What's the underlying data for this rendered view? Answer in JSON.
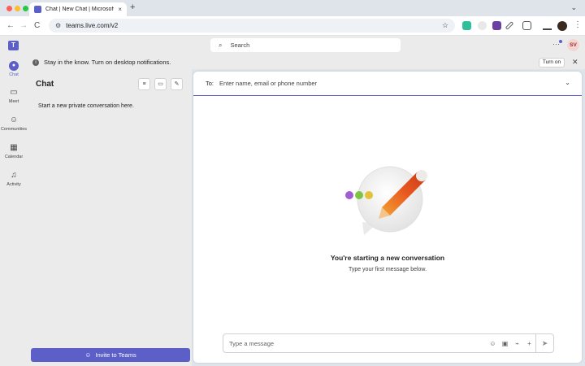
{
  "browser": {
    "tab_title": "Chat | New Chat | Microsoft T",
    "tab_close": "×",
    "new_tab": "+",
    "tab_menu": "⌄",
    "url": "teams.live.com/v2",
    "back": "←",
    "forward": "→",
    "reload": "C",
    "bookmark": "☆",
    "menu": "⋮",
    "colors": {
      "close": "#ff5f57",
      "minimize": "#febc2e",
      "maximize": "#28c840"
    }
  },
  "header": {
    "logo_letter": "T",
    "search_placeholder": "Search",
    "search_icon": "⌕",
    "more": "···",
    "avatar_initials": "SV"
  },
  "banner": {
    "icon": "i",
    "message": "Stay in the know. Turn on desktop notifications.",
    "turn_on": "Turn on",
    "close": "✕"
  },
  "rail": {
    "items": [
      {
        "label": "Chat",
        "icon": "chat-icon",
        "glyph": "●"
      },
      {
        "label": "Meet",
        "icon": "video-icon",
        "glyph": "▭"
      },
      {
        "label": "Communities",
        "icon": "communities-icon",
        "glyph": "☺"
      },
      {
        "label": "Calendar",
        "icon": "calendar-icon",
        "glyph": "▦"
      },
      {
        "label": "Activity",
        "icon": "bell-icon",
        "glyph": "♫"
      }
    ]
  },
  "chatlist": {
    "title": "Chat",
    "filter": "≡",
    "meet": "▭",
    "new_chat": "✎",
    "empty": "Start a new private conversation here.",
    "invite_label": "Invite to Teams",
    "invite_icon": "☺"
  },
  "conversation": {
    "to_label": "To:",
    "to_placeholder": "Enter name, email or phone number",
    "chevron": "⌄",
    "heading": "You're starting a new conversation",
    "subtext": "Type your first message below.",
    "composer_placeholder": "Type a message",
    "emoji": "☺",
    "gif": "▣",
    "attach": "⌁",
    "add": "+",
    "send": "➤"
  },
  "colors": {
    "accent": "#5b5fc7",
    "rail_bg": "#ebebeb",
    "dot_purple": "#a35bd6",
    "dot_green": "#7cc443",
    "dot_yellow": "#e3c23a"
  }
}
